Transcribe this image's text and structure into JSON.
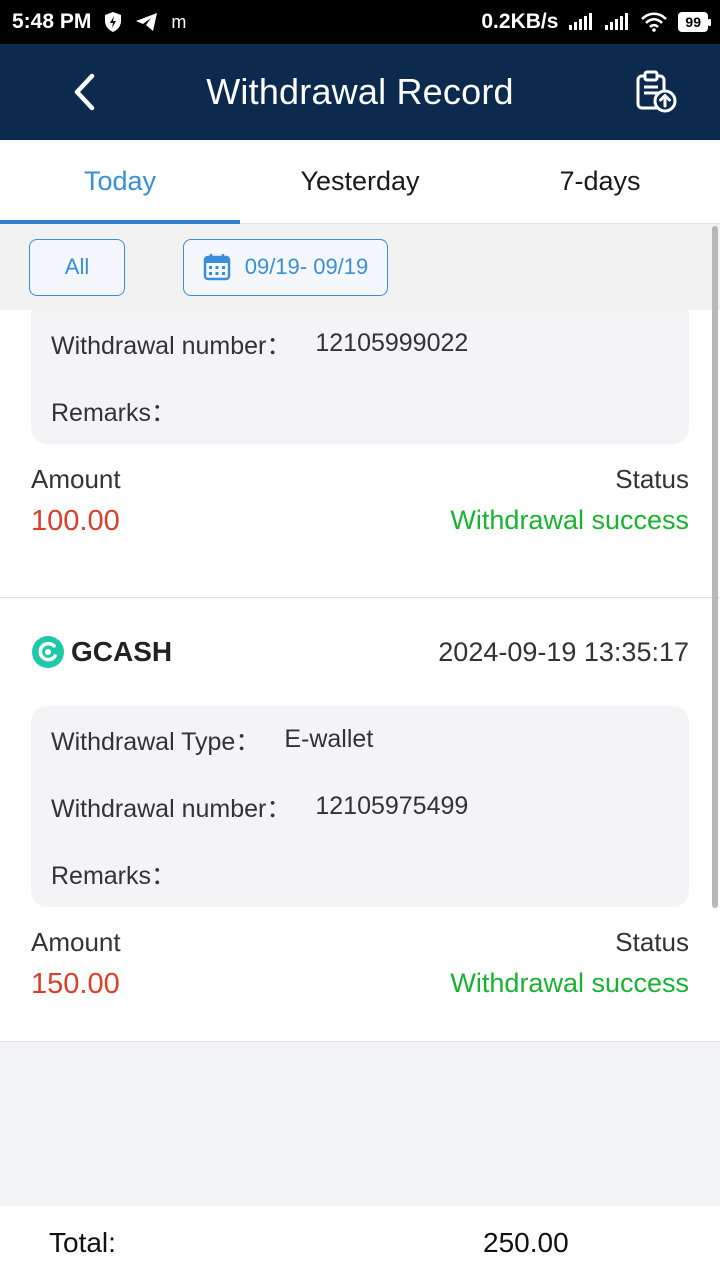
{
  "status_bar": {
    "time": "5:48 PM",
    "app_letter": "m",
    "network_speed": "0.2KB/s",
    "battery": "99"
  },
  "header": {
    "title": "Withdrawal Record",
    "back_icon": "chevron-left-icon",
    "export_icon": "clipboard-upload-icon"
  },
  "tabs": [
    {
      "label": "Today",
      "active": true
    },
    {
      "label": "Yesterday",
      "active": false
    },
    {
      "label": "7-days",
      "active": false
    }
  ],
  "filters": {
    "all_label": "All",
    "date_range": "09/19- 09/19"
  },
  "records": [
    {
      "withdrawal_number_label": "Withdrawal number：",
      "withdrawal_number": "12105999022",
      "remarks_label": "Remarks：",
      "remarks": "",
      "amount_label": "Amount",
      "amount": "100.00",
      "status_label": "Status",
      "status": "Withdrawal success"
    },
    {
      "method": "GCASH",
      "datetime": "2024-09-19 13:35:17",
      "withdrawal_type_label": "Withdrawal Type：",
      "withdrawal_type": "E-wallet",
      "withdrawal_number_label": "Withdrawal number：",
      "withdrawal_number": "12105975499",
      "remarks_label": "Remarks：",
      "remarks": "",
      "amount_label": "Amount",
      "amount": "150.00",
      "status_label": "Status",
      "status": "Withdrawal success"
    }
  ],
  "footer": {
    "total_label": "Total:",
    "total_value": "250.00"
  },
  "colors": {
    "header_bg": "#0c2a4e",
    "accent": "#3a8fd9",
    "amount": "#d9402b",
    "success": "#19b232",
    "gcash": "#1fc9a8"
  }
}
